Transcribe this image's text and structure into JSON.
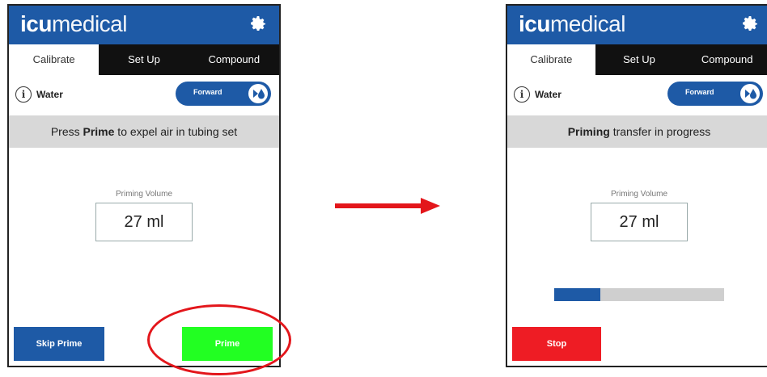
{
  "left_screen": {
    "logo_bold": "icu",
    "logo_light": "medical",
    "tabs": [
      {
        "label": "Calibrate",
        "active": true
      },
      {
        "label": "Set Up",
        "active": false
      },
      {
        "label": "Compound",
        "active": false
      }
    ],
    "fluid": "Water",
    "toggle_label": "Forward",
    "banner_prefix": "Press ",
    "banner_bold": "Prime",
    "banner_suffix": " to expel air in tubing set",
    "priming_label": "Priming Volume",
    "priming_value": "27 ml",
    "skip_label": "Skip Prime",
    "prime_label": "Prime"
  },
  "right_screen": {
    "logo_bold": "icu",
    "logo_light": "medical",
    "tabs": [
      {
        "label": "Calibrate",
        "active": true
      },
      {
        "label": "Set Up",
        "active": false
      },
      {
        "label": "Compound",
        "active": false
      }
    ],
    "fluid": "Water",
    "toggle_label": "Forward",
    "banner_bold": "Priming",
    "banner_suffix": " transfer in progress",
    "priming_label": "Priming Volume",
    "priming_value": "27 ml",
    "progress_fraction": 0.27,
    "stop_label": "Stop"
  },
  "colors": {
    "brand_blue": "#1e5aa6",
    "prime_green": "#22ff22",
    "stop_red": "#ee1c24",
    "annotation_red": "#e3161b"
  },
  "icons": [
    "gear-icon",
    "info-icon",
    "flow-direction-icon",
    "arrow-right-icon"
  ]
}
